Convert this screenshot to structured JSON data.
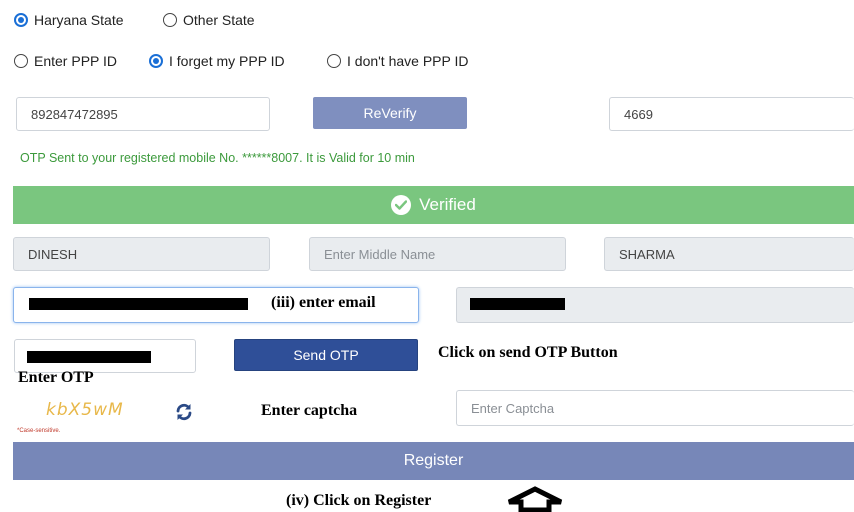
{
  "state_options": [
    {
      "label": "Haryana State",
      "checked": true
    },
    {
      "label": "Other State",
      "checked": false
    }
  ],
  "ppp_options": [
    {
      "label": "Enter PPP ID",
      "checked": false
    },
    {
      "label": "I forget my PPP ID",
      "checked": true
    },
    {
      "label": "I don't have PPP ID",
      "checked": false
    }
  ],
  "aadhaar_value": "892847472895",
  "reverify_label": "ReVerify",
  "otp_value": "4669",
  "otp_message": "OTP Sent to your registered mobile No. ******8007. It is Valid for 10 min",
  "verified_label": "Verified",
  "first_name": "DINESH",
  "middle_name_placeholder": "Enter Middle Name",
  "last_name": "SHARMA",
  "annotations": {
    "email": "(iii) enter email",
    "send_otp": "Click on send OTP Button",
    "enter_otp": "Enter OTP",
    "enter_captcha": "Enter captcha",
    "register": "(iv) Click on Register"
  },
  "send_otp_label": "Send OTP",
  "captcha_text": "kbX5wM",
  "captcha_note": "*Case-sensitive.",
  "captcha_placeholder": "Enter Captcha",
  "register_label": "Register",
  "colors": {
    "verified_green": "#7ac67f",
    "otp_message_green": "#3c9a3c",
    "reverify": "#7f8fbf",
    "send_otp": "#2f4f98",
    "register": "#7787b8",
    "radio_checked": "#1a6fd6"
  }
}
